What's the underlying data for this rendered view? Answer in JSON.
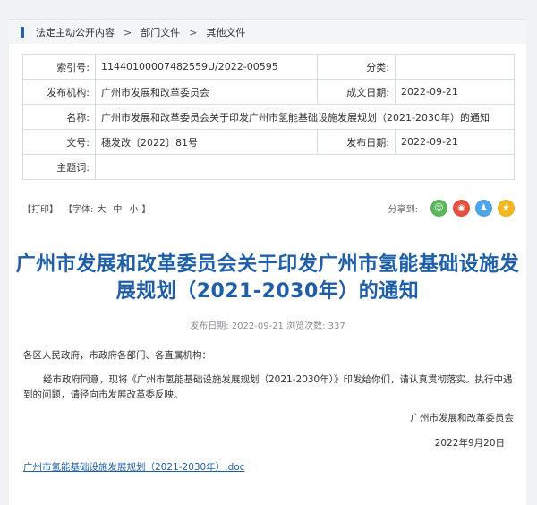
{
  "breadcrumb": {
    "items": [
      "法定主动公开内容",
      "部门文件",
      "其他文件"
    ],
    "separator": ">"
  },
  "meta": {
    "index_label": "索引号:",
    "index_value": "11440100007482559U/2022-00595",
    "category_label": "分类:",
    "category_value": "",
    "issuer_label": "发布机构:",
    "issuer_value": "广州市发展和改革委员会",
    "created_label": "成文日期:",
    "created_value": "2022-09-21",
    "name_label": "名称:",
    "name_value": "广州市发展和改革委员会关于印发广州市氢能基础设施发展规划（2021-2030年）的通知",
    "docno_label": "文号:",
    "docno_value": "穗发改〔2022〕81号",
    "pubdate_label": "发布日期:",
    "pubdate_value": "2022-09-21",
    "subject_label": "主题词:",
    "subject_value": ""
  },
  "toolbar": {
    "print": "【打印】",
    "font_label": "【字体:",
    "font_large": "大",
    "font_medium": "中",
    "font_small": "小",
    "font_close": "】",
    "share_label": "分享到:",
    "share_buttons": [
      {
        "icon": "wechat-icon",
        "color": "#5bb85d",
        "glyph": "☺"
      },
      {
        "icon": "weibo-icon",
        "color": "#e6503f",
        "glyph": "◉"
      },
      {
        "icon": "qq-icon",
        "color": "#4da6e8",
        "glyph": "♟"
      },
      {
        "icon": "qzone-icon",
        "color": "#f5b720",
        "glyph": "★"
      }
    ]
  },
  "article": {
    "title_line1": "广州市发展和改革委员会关于印发广州市氢能基础设施发",
    "title_line2": "展规划（2021-2030年）的通知",
    "pub_info": "发布日期: 2022-09-21  浏览次数: 337",
    "salutation": "各区人民政府，市政府各部门、各直属机构：",
    "paragraph": "经市政府同意，现将《广州市氢能基础设施发展规划（2021-2030年）》印发给你们，请认真贯彻落实。执行中遇到的问题，请径向市发展改革委反映。",
    "signature": "广州市发展和改革委员会",
    "date": "2022年9月20日",
    "attachment": "广州市氢能基础设施发展规划（2021-2030年）.doc"
  },
  "colors": {
    "title": "#1f5fa8",
    "accent_bar": "#2a5ea8",
    "table_border": "#d4dde8"
  }
}
